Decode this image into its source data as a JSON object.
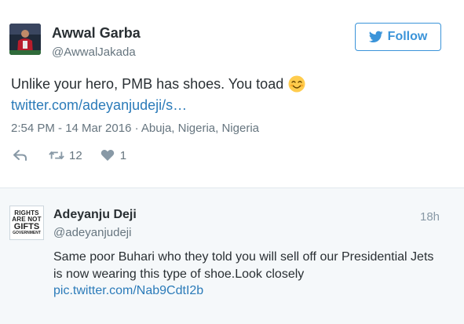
{
  "main_tweet": {
    "author_name": "Awwal Garba",
    "author_handle": "@AwwalJakada",
    "follow_label": "Follow",
    "text": "Unlike your hero, PMB has shoes. You toad",
    "link": "twitter.com/adeyanjudeji/s…",
    "meta": "2:54 PM - 14 Mar 2016 · Abuja, Nigeria, Nigeria",
    "retweet_count": "12",
    "like_count": "1",
    "accent_color": "#3b94d9",
    "link_color": "#2b7bb9"
  },
  "quoted_tweet": {
    "author_name": "Adeyanju Deji",
    "author_handle": "@adeyanjudeji",
    "time": "18h",
    "text": "Same poor Buhari who they told you will sell off our Presidential Jets is now wearing this type of shoe.Look closely",
    "link": "pic.twitter.com/Nab9CdtI2b",
    "avatar_lines": [
      "RIGHTS",
      "ARE NOT",
      "GIFTS",
      "GOVERNMENT"
    ]
  }
}
